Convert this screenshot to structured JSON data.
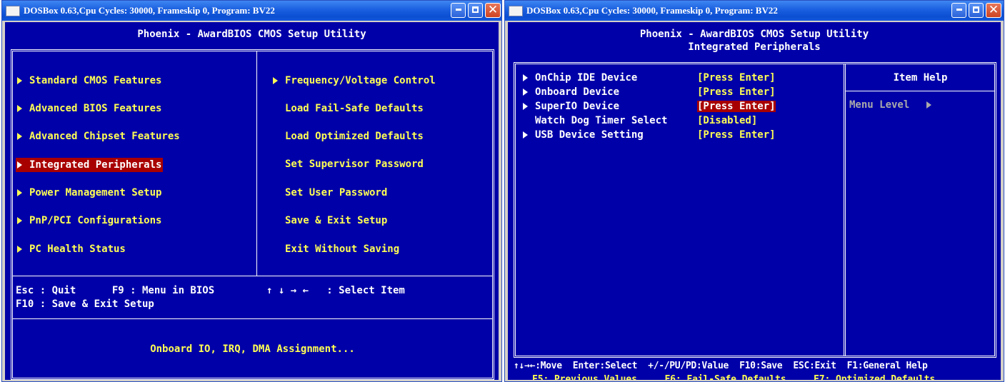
{
  "left": {
    "window_title": "DOSBox 0.63,Cpu Cycles:   30000, Frameskip  0, Program:    BV22",
    "header": "Phoenix - AwardBIOS CMOS Setup Utility",
    "menu_col1": [
      "Standard CMOS Features",
      "Advanced BIOS Features",
      "Advanced Chipset Features",
      "Integrated Peripherals",
      "Power Management Setup",
      "PnP/PCI Configurations",
      "PC Health Status"
    ],
    "selected_item": "Integrated Peripherals",
    "menu_col2": [
      "Frequency/Voltage Control",
      "Load Fail-Safe Defaults",
      "Load Optimized Defaults",
      "Set Supervisor Password",
      "Set User Password",
      "Save & Exit Setup",
      "Exit Without Saving"
    ],
    "keys_line1": "Esc : Quit      F9 : Menu in BIOS",
    "keys_arrows": "↑ ↓ → ←   : Select Item",
    "keys_line2": "F10 : Save & Exit Setup",
    "status": "Onboard IO, IRQ, DMA Assignment..."
  },
  "right": {
    "window_title": "DOSBox 0.63,Cpu Cycles:   30000, Frameskip  0, Program:    BV22",
    "header": "Phoenix - AwardBIOS CMOS Setup Utility",
    "subheader": "Integrated Peripherals",
    "items": [
      {
        "label": "OnChip IDE Device",
        "value": "[Press Enter]",
        "submenu": true
      },
      {
        "label": "Onboard Device",
        "value": "[Press Enter]",
        "submenu": true
      },
      {
        "label": "SuperIO Device",
        "value": "[Press Enter]",
        "submenu": true
      },
      {
        "label": "Watch Dog Timer Select",
        "value": "[Disabled]",
        "submenu": false
      },
      {
        "label": "USB Device Setting",
        "value": "[Press Enter]",
        "submenu": true
      }
    ],
    "item_help_title": "Item Help",
    "menu_level_label": "Menu Level",
    "footer_line1": "↑↓→←:Move  Enter:Select  +/-/PU/PD:Value  F10:Save  ESC:Exit  F1:General Help",
    "footer_line2": "F5: Previous Values     F6: Fail-Safe Defaults     F7: Optimized Defaults"
  },
  "colors": {
    "bios_background": "#0000a8",
    "highlight": "#a80000",
    "menu_text": "#ffff54",
    "titlebar": "#0b4ed2"
  }
}
